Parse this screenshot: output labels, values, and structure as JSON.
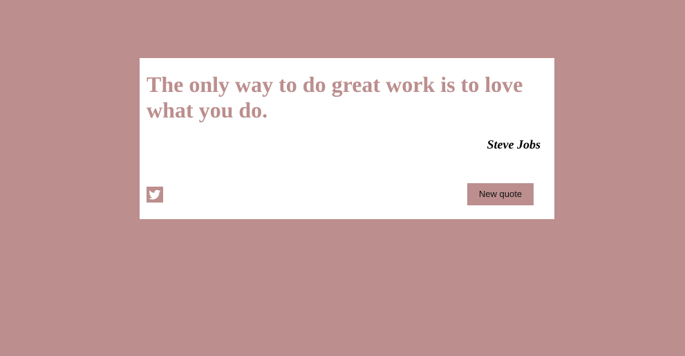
{
  "quote": {
    "text": "The only way to do great work is to love what you do.",
    "author": "Steve Jobs"
  },
  "actions": {
    "tweet_icon": "twitter-icon",
    "new_quote_label": "New quote"
  },
  "colors": {
    "background": "#bc8e8e",
    "card": "#ffffff",
    "quote_text": "#bc8e8e",
    "author_text": "#000000",
    "button": "#bc8e8e"
  }
}
